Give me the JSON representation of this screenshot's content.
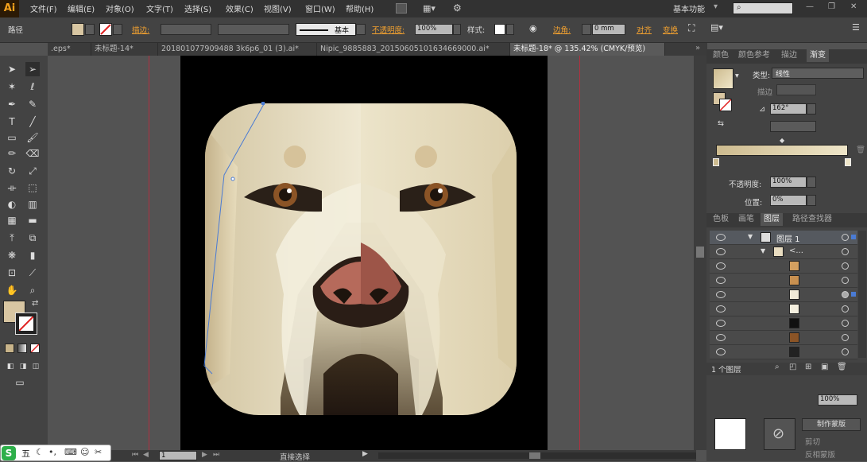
{
  "app": {
    "logo": "Ai",
    "workspace": "基本功能",
    "search_placeholder": ""
  },
  "menu": [
    "文件(F)",
    "编辑(E)",
    "对象(O)",
    "文字(T)",
    "选择(S)",
    "效果(C)",
    "视图(V)",
    "窗口(W)",
    "帮助(H)"
  ],
  "control_bar": {
    "selection_label": "路径",
    "stroke_label": "描边:",
    "stroke_style": "基本",
    "opacity_label": "不透明度:",
    "opacity_value": "100%",
    "style_label": "样式:",
    "corner_label": "边角:",
    "corner_value": "0 mm",
    "align_label": "对齐",
    "transform_label": "变换"
  },
  "tabs": [
    {
      "label": ".eps*",
      "active": false
    },
    {
      "label": "未标题-14*",
      "active": false
    },
    {
      "label": "201801077909488 3k6p6_01 (3).ai*",
      "active": false
    },
    {
      "label": "Nipic_9885883_20150605101634669000.ai*",
      "active": false
    },
    {
      "label": "未标题-18* @ 135.42% (CMYK/预览)",
      "active": true
    }
  ],
  "gradient_panel": {
    "tabs": [
      "颜色",
      "颜色参考",
      "描边",
      "渐变"
    ],
    "type_label": "类型:",
    "type_value": "线性",
    "stroke_label": "描边",
    "angle_value": "162°",
    "opacity_label": "不透明度:",
    "opacity_value": "100%",
    "position_label": "位置:",
    "position_value": "0%",
    "ramp_start": "#cdbb8f",
    "ramp_end": "#efe6c9"
  },
  "layers_panel": {
    "tabs": [
      "色板",
      "画笔",
      "图层",
      "路径查找器"
    ],
    "layer_name": "图层 1",
    "group_name": "<...",
    "count_label": "1 个图层"
  },
  "bottom_panel": {
    "make_mask": "制作蒙版",
    "clip": "剪切",
    "invert_mask": "反相蒙版",
    "opacity_value": "100%"
  },
  "status": {
    "zoom": "1",
    "tool": "直接选择"
  },
  "ime": {
    "label": "五"
  },
  "colors": {
    "fill": "#d8c6a2",
    "artboard": "#000000",
    "guide": "#b03040"
  }
}
